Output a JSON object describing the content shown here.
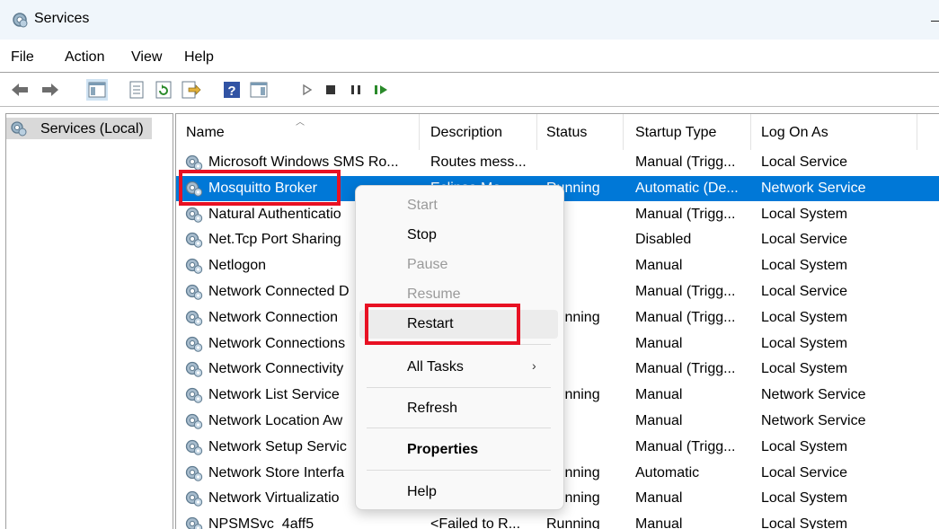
{
  "window": {
    "title": "Services",
    "icon": "services-gear-icon"
  },
  "menu": [
    "File",
    "Action",
    "View",
    "Help"
  ],
  "toolbar": {
    "icons": [
      "back-arrow-icon",
      "forward-arrow-icon",
      "show-hide-console-tree-icon",
      "properties-icon",
      "refresh-icon",
      "export-list-icon",
      "help-icon",
      "show-hide-action-pane-icon",
      "start-service-icon",
      "stop-service-icon",
      "pause-service-icon",
      "resume-service-icon"
    ]
  },
  "tree": {
    "label": "Services (Local)"
  },
  "columns": [
    "Name",
    "Description",
    "Status",
    "Startup Type",
    "Log On As"
  ],
  "rows": [
    {
      "name": "Microsoft Windows SMS Ro...",
      "description": "Routes mess...",
      "status": "",
      "startup": "Manual (Trigg...",
      "logon": "Local Service"
    },
    {
      "name": "Mosquitto Broker",
      "description": "Eclipse Mo...",
      "status": "Running",
      "startup": "Automatic (De...",
      "logon": "Network Service"
    },
    {
      "name": "Natural Authenticatio",
      "description": "",
      "status": "",
      "startup": "Manual (Trigg...",
      "logon": "Local System"
    },
    {
      "name": "Net.Tcp Port Sharing",
      "description": "",
      "status": "",
      "startup": "Disabled",
      "logon": "Local Service"
    },
    {
      "name": "Netlogon",
      "description": "",
      "status": "",
      "startup": "Manual",
      "logon": "Local System"
    },
    {
      "name": "Network Connected D",
      "description": "",
      "status": "",
      "startup": "Manual (Trigg...",
      "logon": "Local Service"
    },
    {
      "name": "Network Connection",
      "description": "",
      "status": "Running",
      "startup": "Manual (Trigg...",
      "logon": "Local System"
    },
    {
      "name": "Network Connections",
      "description": "",
      "status": "",
      "startup": "Manual",
      "logon": "Local System"
    },
    {
      "name": "Network Connectivity",
      "description": "",
      "status": "",
      "startup": "Manual (Trigg...",
      "logon": "Local System"
    },
    {
      "name": "Network List Service",
      "description": "",
      "status": "Running",
      "startup": "Manual",
      "logon": "Network Service"
    },
    {
      "name": "Network Location Aw",
      "description": "",
      "status": "",
      "startup": "Manual",
      "logon": "Network Service"
    },
    {
      "name": "Network Setup Servic",
      "description": "",
      "status": "",
      "startup": "Manual (Trigg...",
      "logon": "Local System"
    },
    {
      "name": "Network Store Interfa",
      "description": "",
      "status": "Running",
      "startup": "Automatic",
      "logon": "Local Service"
    },
    {
      "name": "Network Virtualizatio",
      "description": "",
      "status": "Running",
      "startup": "Manual",
      "logon": "Local System"
    },
    {
      "name": "NPSMSvc_4aff5",
      "description": "<Failed to R...",
      "status": "Running",
      "startup": "Manual",
      "logon": "Local System"
    }
  ],
  "context_menu": {
    "start": "Start",
    "stop": "Stop",
    "pause": "Pause",
    "resume": "Resume",
    "restart": "Restart",
    "all_tasks": "All Tasks",
    "submenu_arrow": "›",
    "refresh": "Refresh",
    "properties": "Properties",
    "help": "Help"
  },
  "colors": {
    "selection": "#0078d7",
    "highlight_box": "#e81123"
  }
}
